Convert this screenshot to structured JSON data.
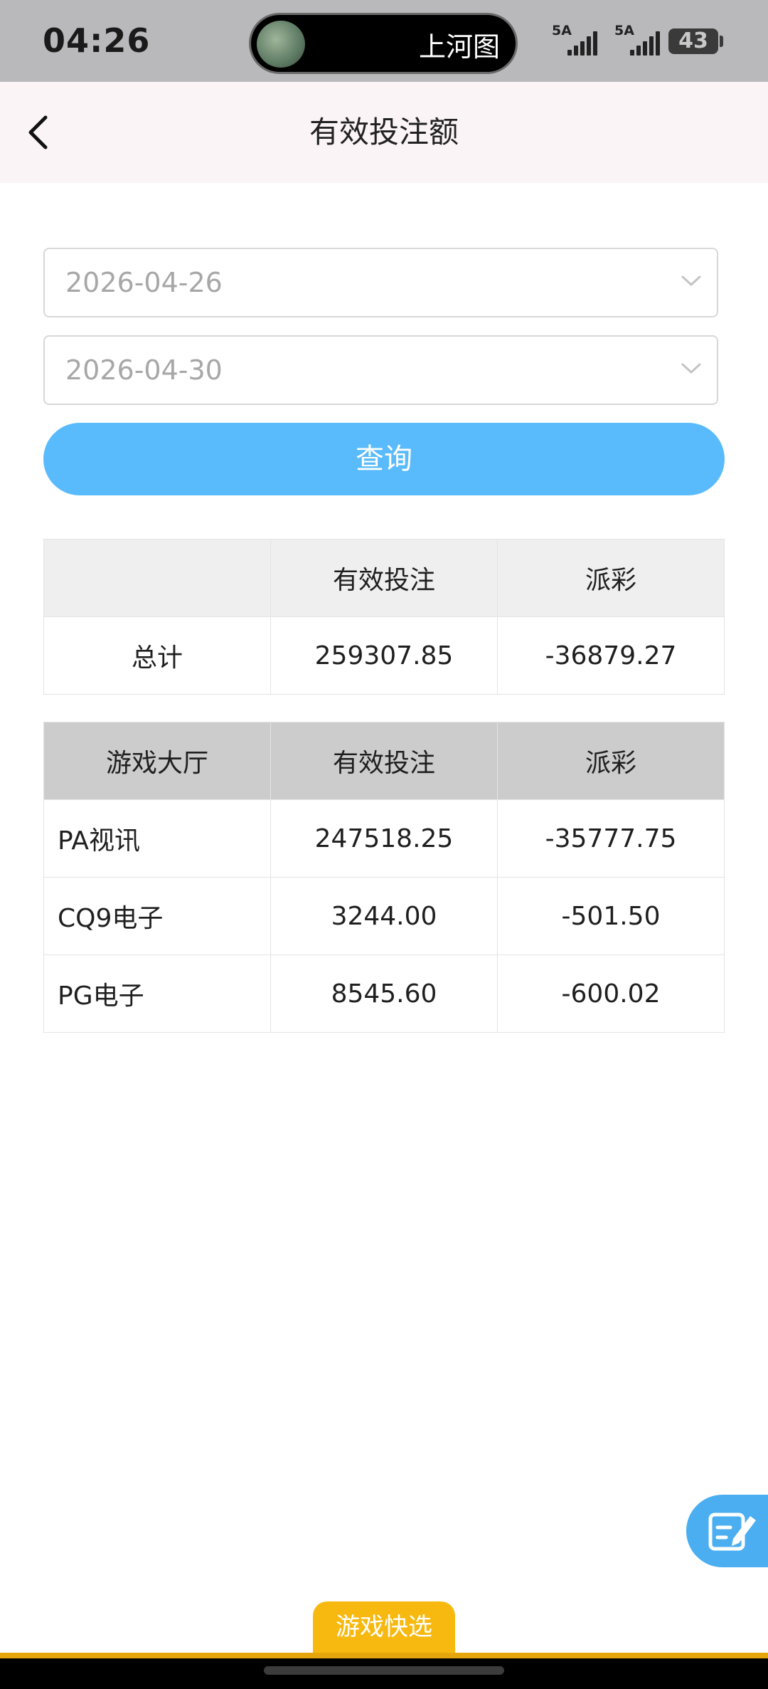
{
  "status_bar": {
    "time": "04:26",
    "island_text": "上河图",
    "signal1": "5A",
    "signal2": "5A",
    "battery": "43"
  },
  "navbar": {
    "title": "有效投注额"
  },
  "filters": {
    "start_date": "2026-04-26",
    "end_date": "2026-04-30",
    "query_label": "查询"
  },
  "summary_table": {
    "headers": [
      "",
      "有效投注",
      "派彩"
    ],
    "rows": [
      [
        "总计",
        "259307.85",
        "-36879.27"
      ]
    ]
  },
  "detail_table": {
    "headers": [
      "游戏大厅",
      "有效投注",
      "派彩"
    ],
    "rows": [
      [
        "PA视讯",
        "247518.25",
        "-35777.75"
      ],
      [
        "CQ9电子",
        "3244.00",
        "-501.50"
      ],
      [
        "PG电子",
        "8545.60",
        "-600.02"
      ]
    ]
  },
  "bottom": {
    "tab_label": "游戏快选"
  },
  "icons": {
    "back": "chevron-left-icon",
    "dropdown": "chevron-down-icon",
    "fab": "edit-note-icon"
  },
  "colors": {
    "accent_blue": "#59bbfb",
    "fab_blue": "#4aaef1",
    "bottom_gold": "#f7b90f"
  }
}
